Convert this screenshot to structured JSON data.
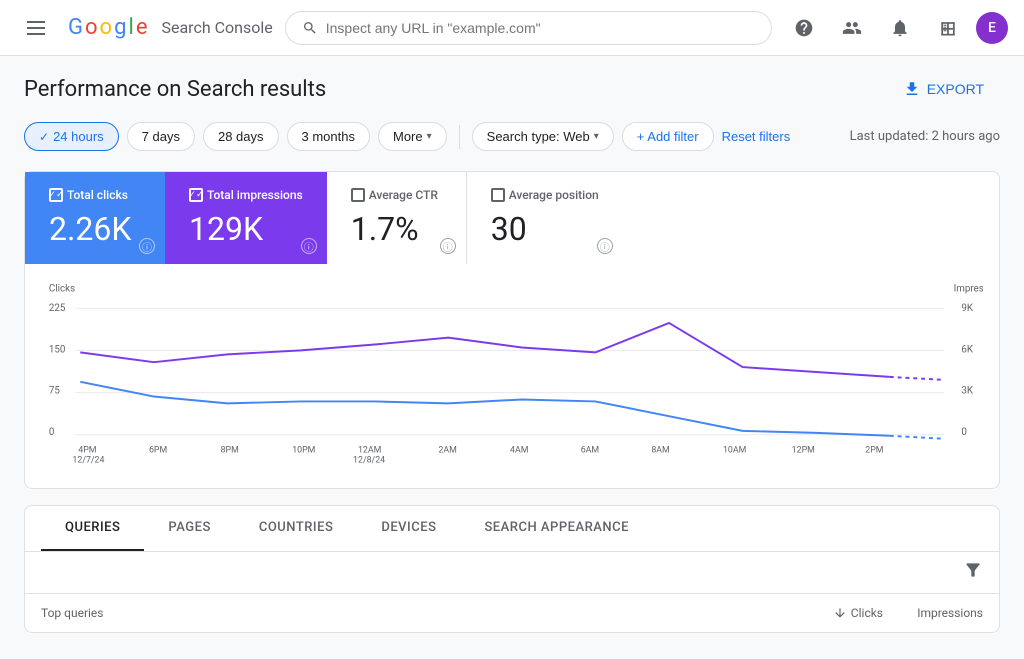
{
  "app": {
    "title": "Search Console",
    "logo_letters": [
      "G",
      "o",
      "o",
      "g",
      "l",
      "e"
    ],
    "logo_colors": [
      "#4285f4",
      "#ea4335",
      "#fbbc05",
      "#4285f4",
      "#34a853",
      "#ea4335"
    ]
  },
  "header": {
    "search_placeholder": "Inspect any URL in \"example.com\"",
    "avatar_initial": "E"
  },
  "page": {
    "title": "Performance on Search results",
    "export_label": "EXPORT",
    "last_updated": "Last updated: 2 hours ago"
  },
  "filters": {
    "time_options": [
      {
        "label": "24 hours",
        "active": true
      },
      {
        "label": "7 days",
        "active": false
      },
      {
        "label": "28 days",
        "active": false
      },
      {
        "label": "3 months",
        "active": false
      },
      {
        "label": "More",
        "active": false,
        "dropdown": true
      }
    ],
    "search_type_label": "Search type: Web",
    "add_filter_label": "+ Add filter",
    "reset_filters_label": "Reset filters"
  },
  "metrics": {
    "total_clicks": {
      "label": "Total clicks",
      "value": "2.26K"
    },
    "total_impressions": {
      "label": "Total impressions",
      "value": "129K"
    },
    "avg_ctr": {
      "label": "Average CTR",
      "value": "1.7%"
    },
    "avg_position": {
      "label": "Average position",
      "value": "30"
    }
  },
  "chart": {
    "y_left_label": "Clicks",
    "y_right_label": "Impressions",
    "y_left_ticks": [
      "225",
      "150",
      "75",
      "0"
    ],
    "y_right_ticks": [
      "9K",
      "6K",
      "3K",
      "0"
    ],
    "x_labels": [
      "4PM\n12/7/24",
      "6PM",
      "8PM",
      "10PM",
      "12AM\n12/8/24",
      "2AM",
      "4AM",
      "6AM",
      "8AM",
      "10AM",
      "12PM",
      "2PM"
    ]
  },
  "tabs": {
    "items": [
      {
        "label": "QUERIES",
        "active": true
      },
      {
        "label": "PAGES",
        "active": false
      },
      {
        "label": "COUNTRIES",
        "active": false
      },
      {
        "label": "DEVICES",
        "active": false
      },
      {
        "label": "SEARCH APPEARANCE",
        "active": false
      }
    ],
    "table_header": {
      "query_col": "Top queries",
      "clicks_col": "Clicks",
      "impressions_col": "Impressions"
    }
  }
}
